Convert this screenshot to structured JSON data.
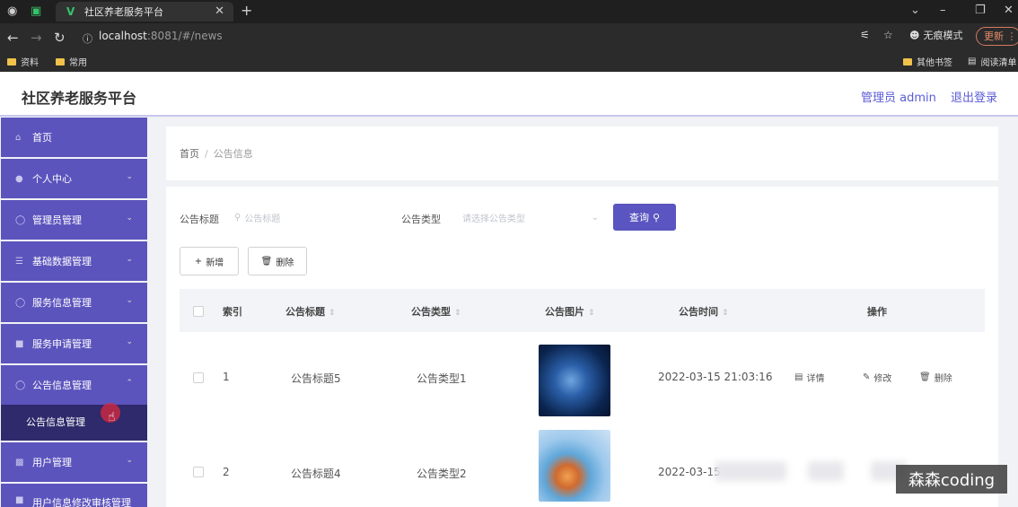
{
  "browser": {
    "tab_title": "社区养老服务平台",
    "url_host": "localhost",
    "url_path": ":8081/#/news",
    "incognito_label": "无痕模式",
    "update_label": "更新",
    "bookmarks": [
      "资料",
      "常用",
      "其他书签",
      "阅读清单"
    ]
  },
  "app": {
    "title": "社区养老服务平台",
    "admin_label": "管理员 admin",
    "logout_label": "退出登录"
  },
  "sidebar": {
    "items": [
      {
        "label": "首页",
        "icon": "home-icon"
      },
      {
        "label": "个人中心",
        "icon": "user-icon"
      },
      {
        "label": "管理员管理",
        "icon": "admin-icon"
      },
      {
        "label": "基础数据管理",
        "icon": "list-icon"
      },
      {
        "label": "服务信息管理",
        "icon": "service-icon"
      },
      {
        "label": "服务申请管理",
        "icon": "apply-icon"
      },
      {
        "label": "公告信息管理",
        "icon": "notice-icon"
      },
      {
        "label": "用户管理",
        "icon": "users-icon"
      },
      {
        "label": "用户信息修改审核管理",
        "icon": "audit-icon"
      }
    ],
    "active_sub_item": "公告信息管理"
  },
  "breadcrumb": {
    "home": "首页",
    "separator": "/",
    "current": "公告信息"
  },
  "search": {
    "title_label": "公告标题",
    "title_placeholder": "公告标题",
    "type_label": "公告类型",
    "type_placeholder": "请选择公告类型",
    "search_button": "查询"
  },
  "actions": {
    "add_label": "新增",
    "delete_label": "删除"
  },
  "table": {
    "headers": [
      "索引",
      "公告标题",
      "公告类型",
      "公告图片",
      "公告时间",
      "操作"
    ],
    "rows": [
      {
        "index": "1",
        "title": "公告标题5",
        "type": "公告类型1",
        "time": "2022-03-15 21:03:16"
      },
      {
        "index": "2",
        "title": "公告标题4",
        "type": "公告类型2",
        "time": "2022-03-15"
      }
    ],
    "op_labels": {
      "detail": "详情",
      "edit": "修改",
      "delete": "删除"
    }
  },
  "watermark": "森森coding"
}
